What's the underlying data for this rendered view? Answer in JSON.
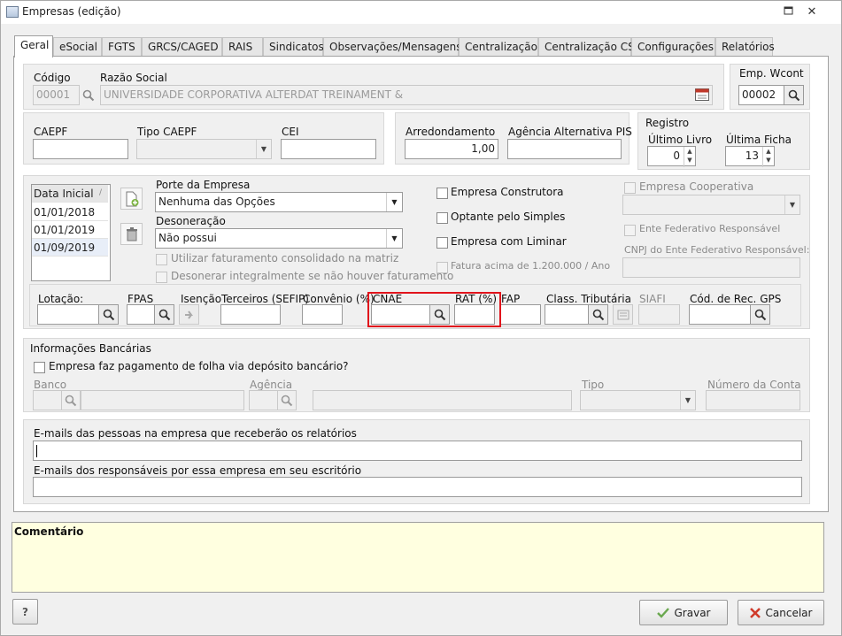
{
  "window": {
    "title": "Empresas (edição)"
  },
  "tabs": [
    "Geral",
    "eSocial",
    "FGTS",
    "GRCS/CAGED",
    "RAIS",
    "Sindicatos",
    "Observações/Mensagens",
    "Centralização",
    "Centralização CS",
    "Configurações",
    "Relatórios"
  ],
  "identity": {
    "codigo_label": "Código",
    "codigo_value": "00001",
    "razao_label": "Razão Social",
    "razao_value": "UNIVERSIDADE CORPORATIVA ALTERDAT TREINAMENT &",
    "emp_label": "Emp. Wcont",
    "emp_value": "00002"
  },
  "caepf": {
    "caepf_label": "CAEPF",
    "tipo_label": "Tipo CAEPF",
    "cei_label": "CEI",
    "arredondamento_label": "Arredondamento",
    "arredondamento_value": "1,00",
    "agencia_label": "Agência Alternativa PIS"
  },
  "registro": {
    "title": "Registro",
    "livro_label": "Último Livro",
    "livro_value": "0",
    "ficha_label": "Última Ficha",
    "ficha_value": "13"
  },
  "datas": {
    "header": "Data Inicial",
    "items": [
      "01/01/2018",
      "01/01/2019",
      "01/09/2019"
    ]
  },
  "porte": {
    "porte_label": "Porte da Empresa",
    "porte_value": "Nenhuma das Opções",
    "deson_label": "Desoneração",
    "deson_value": "Não possui",
    "chk_consolidado": "Utilizar faturamento consolidado na matriz",
    "chk_desonerar": "Desonerar integralmente se não houver faturamento"
  },
  "flags": {
    "construtora": "Empresa Construtora",
    "simples": "Optante pelo Simples",
    "liminar": "Empresa com Liminar",
    "fatura": "Fatura acima de 1.200.000 / Ano",
    "cooperativa": "Empresa Cooperativa",
    "ente": "Ente Federativo Responsável",
    "cnpj_ente": "CNPJ do Ente Federativo Responsável:"
  },
  "lotacao": {
    "lotacao": "Lotação:",
    "fpas": "FPAS",
    "isencao": "Isenção",
    "terceiros": "Terceiros (SEFIP)",
    "convenio": "Convênio (%)",
    "cnae": "CNAE",
    "rat": "RAT (%)",
    "fap": "FAP",
    "class": "Class. Tributária",
    "siafi": "SIAFI",
    "gps": "Cód. de Rec. GPS"
  },
  "bancarias": {
    "title": "Informações Bancárias",
    "chk": "Empresa faz pagamento de folha via depósito bancário?",
    "banco": "Banco",
    "agencia": "Agência",
    "tipo": "Tipo",
    "conta": "Número da Conta"
  },
  "emails": {
    "relatorios_label": "E-mails das pessoas na empresa que receberão os relatórios",
    "responsaveis_label": "E-mails dos responsáveis por essa empresa em seu escritório"
  },
  "comentario": {
    "label": "Comentário"
  },
  "footer": {
    "help": "?",
    "gravar": "Gravar",
    "cancelar": "Cancelar"
  },
  "colors": {
    "highlight": "#e1141c",
    "comment_bg": "#ffffe0"
  }
}
